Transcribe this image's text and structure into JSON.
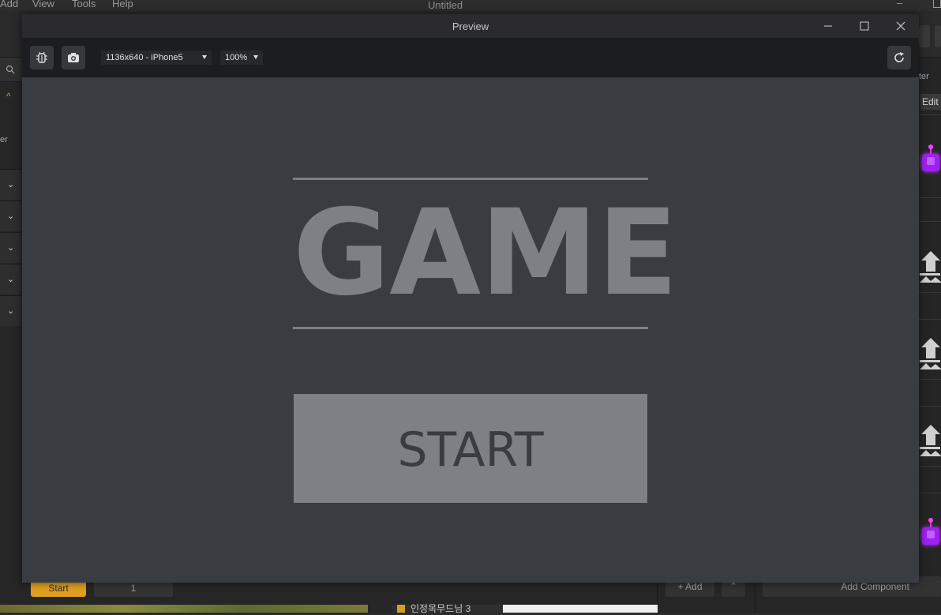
{
  "editor": {
    "menu": [
      "Add",
      "View",
      "Tools",
      "Help"
    ],
    "title": "Untitled",
    "left_panel": {
      "truncated_label": "er"
    },
    "right_panel": {
      "truncated_label": "ter",
      "edit_label": "Edit"
    },
    "bottom": {
      "start_label": "Start",
      "field_value": "1",
      "add_label": "+ Add",
      "add_component_label": "Add Component",
      "file_name": "인정목무드님 3"
    }
  },
  "preview": {
    "window_title": "Preview",
    "resolution_select": "1136x640 - iPhone5",
    "zoom_select": "100%",
    "game": {
      "title": "GAME",
      "start_button": "START"
    }
  }
}
